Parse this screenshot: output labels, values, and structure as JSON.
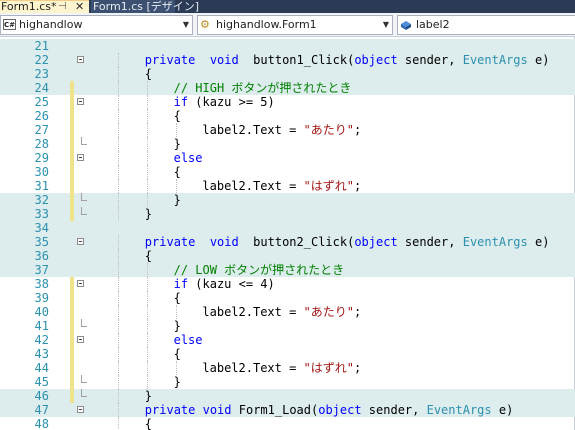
{
  "tabs": [
    {
      "label": "Form1.cs*",
      "active": true
    },
    {
      "label": "Form1.cs [デザイン]",
      "active": false
    }
  ],
  "nav": {
    "project": "highandlow",
    "class": "highandlow.Form1",
    "member": "label2"
  },
  "lines": [
    {
      "n": "21",
      "band": true,
      "fold": "",
      "chg": false,
      "tokens": []
    },
    {
      "n": "22",
      "band": true,
      "fold": "box",
      "chg": false,
      "indent": 1,
      "tokens": [
        [
          "kw",
          "private"
        ],
        [
          "",
          "  "
        ],
        [
          "kw",
          "void"
        ],
        [
          "",
          "  button1_Click("
        ],
        [
          "kw",
          "object"
        ],
        [
          "",
          " sender, "
        ],
        [
          "ty",
          "EventArgs"
        ],
        [
          "",
          " e)"
        ]
      ]
    },
    {
      "n": "23",
      "band": true,
      "fold": "",
      "chg": false,
      "indent": 1,
      "tokens": [
        [
          "",
          "{"
        ]
      ]
    },
    {
      "n": "24",
      "band": true,
      "fold": "",
      "chg": true,
      "indent": 2,
      "tokens": [
        [
          "cm",
          "// HIGH ボタンが押されたとき"
        ]
      ]
    },
    {
      "n": "25",
      "band": false,
      "fold": "box",
      "chg": true,
      "indent": 2,
      "tokens": [
        [
          "kw",
          "if"
        ],
        [
          "",
          " (kazu >= 5)"
        ]
      ]
    },
    {
      "n": "26",
      "band": false,
      "fold": "",
      "chg": true,
      "indent": 2,
      "tokens": [
        [
          "",
          "{"
        ]
      ]
    },
    {
      "n": "27",
      "band": false,
      "fold": "",
      "chg": true,
      "indent": 3,
      "tokens": [
        [
          "",
          "label2.Text = "
        ],
        [
          "st",
          "\"あたり\""
        ],
        [
          "",
          ";"
        ]
      ]
    },
    {
      "n": "28",
      "band": false,
      "fold": "end",
      "chg": true,
      "indent": 2,
      "tokens": [
        [
          "",
          "}"
        ]
      ]
    },
    {
      "n": "29",
      "band": false,
      "fold": "box",
      "chg": true,
      "indent": 2,
      "tokens": [
        [
          "kw",
          "else"
        ]
      ]
    },
    {
      "n": "30",
      "band": false,
      "fold": "",
      "chg": true,
      "indent": 2,
      "tokens": [
        [
          "",
          "{"
        ]
      ]
    },
    {
      "n": "31",
      "band": false,
      "fold": "",
      "chg": true,
      "indent": 3,
      "tokens": [
        [
          "",
          "label2.Text = "
        ],
        [
          "st",
          "\"はずれ\""
        ],
        [
          "",
          ";"
        ]
      ]
    },
    {
      "n": "32",
      "band": true,
      "fold": "end",
      "chg": true,
      "indent": 2,
      "tokens": [
        [
          "",
          "}"
        ]
      ]
    },
    {
      "n": "33",
      "band": true,
      "fold": "end",
      "chg": true,
      "indent": 1,
      "tokens": [
        [
          "",
          "}"
        ]
      ]
    },
    {
      "n": "34",
      "band": true,
      "fold": "",
      "chg": false,
      "tokens": []
    },
    {
      "n": "35",
      "band": true,
      "fold": "box",
      "chg": false,
      "indent": 1,
      "tokens": [
        [
          "kw",
          "private"
        ],
        [
          "",
          "  "
        ],
        [
          "kw",
          "void"
        ],
        [
          "",
          "  button2_Click("
        ],
        [
          "kw",
          "object"
        ],
        [
          "",
          " sender, "
        ],
        [
          "ty",
          "EventArgs"
        ],
        [
          "",
          " e)"
        ]
      ]
    },
    {
      "n": "36",
      "band": true,
      "fold": "",
      "chg": false,
      "indent": 1,
      "tokens": [
        [
          "",
          "{"
        ]
      ]
    },
    {
      "n": "37",
      "band": true,
      "fold": "",
      "chg": false,
      "indent": 2,
      "tokens": [
        [
          "cm",
          "// LOW ボタンが押されたとき"
        ]
      ]
    },
    {
      "n": "38",
      "band": false,
      "fold": "box",
      "chg": true,
      "indent": 2,
      "tokens": [
        [
          "kw",
          "if"
        ],
        [
          "",
          " (kazu <= 4)"
        ]
      ]
    },
    {
      "n": "39",
      "band": false,
      "fold": "",
      "chg": true,
      "indent": 2,
      "tokens": [
        [
          "",
          "{"
        ]
      ]
    },
    {
      "n": "40",
      "band": false,
      "fold": "",
      "chg": true,
      "indent": 3,
      "tokens": [
        [
          "",
          "label2.Text = "
        ],
        [
          "st",
          "\"あたり\""
        ],
        [
          "",
          ";"
        ]
      ]
    },
    {
      "n": "41",
      "band": false,
      "fold": "end",
      "chg": true,
      "indent": 2,
      "tokens": [
        [
          "",
          "}"
        ]
      ]
    },
    {
      "n": "42",
      "band": false,
      "fold": "box",
      "chg": true,
      "indent": 2,
      "tokens": [
        [
          "kw",
          "else"
        ]
      ]
    },
    {
      "n": "43",
      "band": false,
      "fold": "",
      "chg": true,
      "indent": 2,
      "tokens": [
        [
          "",
          "{"
        ]
      ]
    },
    {
      "n": "44",
      "band": false,
      "fold": "",
      "chg": true,
      "indent": 3,
      "tokens": [
        [
          "",
          "label2.Text = "
        ],
        [
          "st",
          "\"はずれ\""
        ],
        [
          "",
          ";"
        ]
      ]
    },
    {
      "n": "45",
      "band": false,
      "fold": "end",
      "chg": true,
      "indent": 2,
      "tokens": [
        [
          "",
          "}"
        ]
      ]
    },
    {
      "n": "46",
      "band": true,
      "fold": "end",
      "chg": true,
      "indent": 1,
      "tokens": [
        [
          "",
          "}"
        ]
      ]
    },
    {
      "n": "47",
      "band": true,
      "fold": "box",
      "chg": false,
      "indent": 1,
      "tokens": [
        [
          "kw",
          "private"
        ],
        [
          "",
          " "
        ],
        [
          "kw",
          "void"
        ],
        [
          "",
          " Form1_Load("
        ],
        [
          "kw",
          "object"
        ],
        [
          "",
          " sender, "
        ],
        [
          "ty",
          "EventArgs"
        ],
        [
          "",
          " e)"
        ]
      ]
    },
    {
      "n": "48",
      "band": false,
      "fold": "",
      "chg": false,
      "indent": 1,
      "tokens": [
        [
          "",
          "{"
        ]
      ]
    }
  ],
  "colors": {
    "keyword": "#0000ff",
    "type": "#2b91af",
    "comment": "#008000",
    "string": "#a31515",
    "band": "#ddeced",
    "change_marker": "#efe38a"
  }
}
